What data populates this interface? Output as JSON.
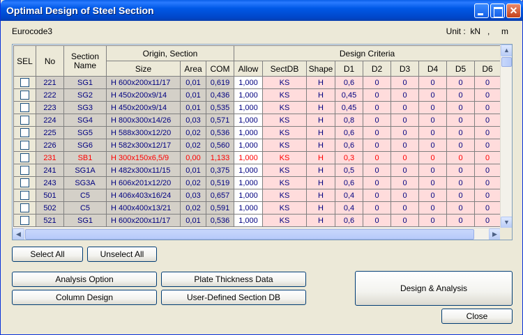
{
  "window": {
    "title": "Optimal Design of Steel Section",
    "code": "Eurocode3",
    "unit_text": "Unit :  kN   ,     m"
  },
  "table": {
    "group_headers": {
      "origin": "Origin, Section",
      "criteria": "Design Criteria"
    },
    "columns": {
      "sel": "SEL",
      "no": "No",
      "section_name": "Section Name",
      "size": "Size",
      "area": "Area",
      "com": "COM",
      "allow": "Allow",
      "sectdb": "SectDB",
      "shape": "Shape",
      "d1": "D1",
      "d2": "D2",
      "d3": "D3",
      "d4": "D4",
      "d5": "D5",
      "d6": "D6"
    },
    "rows": [
      {
        "no": "221",
        "name": "SG1",
        "size": "H 600x200x11/17",
        "area": "0,01",
        "com": "0,619",
        "allow": "1,000",
        "sectdb": "KS",
        "shape": "H",
        "d1": "0,6",
        "d2": "0",
        "d3": "0",
        "d4": "0",
        "d5": "0",
        "d6": "0"
      },
      {
        "no": "222",
        "name": "SG2",
        "size": "H 450x200x9/14",
        "area": "0,01",
        "com": "0,436",
        "allow": "1,000",
        "sectdb": "KS",
        "shape": "H",
        "d1": "0,45",
        "d2": "0",
        "d3": "0",
        "d4": "0",
        "d5": "0",
        "d6": "0"
      },
      {
        "no": "223",
        "name": "SG3",
        "size": "H 450x200x9/14",
        "area": "0,01",
        "com": "0,535",
        "allow": "1,000",
        "sectdb": "KS",
        "shape": "H",
        "d1": "0,45",
        "d2": "0",
        "d3": "0",
        "d4": "0",
        "d5": "0",
        "d6": "0"
      },
      {
        "no": "224",
        "name": "SG4",
        "size": "H 800x300x14/26",
        "area": "0,03",
        "com": "0,571",
        "allow": "1,000",
        "sectdb": "KS",
        "shape": "H",
        "d1": "0,8",
        "d2": "0",
        "d3": "0",
        "d4": "0",
        "d5": "0",
        "d6": "0"
      },
      {
        "no": "225",
        "name": "SG5",
        "size": "H 588x300x12/20",
        "area": "0,02",
        "com": "0,536",
        "allow": "1,000",
        "sectdb": "KS",
        "shape": "H",
        "d1": "0,6",
        "d2": "0",
        "d3": "0",
        "d4": "0",
        "d5": "0",
        "d6": "0"
      },
      {
        "no": "226",
        "name": "SG6",
        "size": "H 582x300x12/17",
        "area": "0,02",
        "com": "0,560",
        "allow": "1,000",
        "sectdb": "KS",
        "shape": "H",
        "d1": "0,6",
        "d2": "0",
        "d3": "0",
        "d4": "0",
        "d5": "0",
        "d6": "0"
      },
      {
        "no": "231",
        "name": "SB1",
        "size": "H 300x150x6,5/9",
        "area": "0,00",
        "com": "1,133",
        "allow": "1,000",
        "sectdb": "KS",
        "shape": "H",
        "d1": "0,3",
        "d2": "0",
        "d3": "0",
        "d4": "0",
        "d5": "0",
        "d6": "0",
        "warn": true
      },
      {
        "no": "241",
        "name": "SG1A",
        "size": "H 482x300x11/15",
        "area": "0,01",
        "com": "0,375",
        "allow": "1,000",
        "sectdb": "KS",
        "shape": "H",
        "d1": "0,5",
        "d2": "0",
        "d3": "0",
        "d4": "0",
        "d5": "0",
        "d6": "0"
      },
      {
        "no": "243",
        "name": "SG3A",
        "size": "H 606x201x12/20",
        "area": "0,02",
        "com": "0,519",
        "allow": "1,000",
        "sectdb": "KS",
        "shape": "H",
        "d1": "0,6",
        "d2": "0",
        "d3": "0",
        "d4": "0",
        "d5": "0",
        "d6": "0"
      },
      {
        "no": "501",
        "name": "C5",
        "size": "H 406x403x16/24",
        "area": "0,03",
        "com": "0,657",
        "allow": "1,000",
        "sectdb": "KS",
        "shape": "H",
        "d1": "0,4",
        "d2": "0",
        "d3": "0",
        "d4": "0",
        "d5": "0",
        "d6": "0"
      },
      {
        "no": "502",
        "name": "C5",
        "size": "H 400x400x13/21",
        "area": "0,02",
        "com": "0,591",
        "allow": "1,000",
        "sectdb": "KS",
        "shape": "H",
        "d1": "0,4",
        "d2": "0",
        "d3": "0",
        "d4": "0",
        "d5": "0",
        "d6": "0"
      },
      {
        "no": "521",
        "name": "SG1",
        "size": "H 600x200x11/17",
        "area": "0,01",
        "com": "0,536",
        "allow": "1,000",
        "sectdb": "KS",
        "shape": "H",
        "d1": "0,6",
        "d2": "0",
        "d3": "0",
        "d4": "0",
        "d5": "0",
        "d6": "0"
      }
    ]
  },
  "buttons": {
    "select_all": "Select All",
    "unselect_all": "Unselect All",
    "analysis_option": "Analysis Option",
    "plate_thickness": "Plate Thickness Data",
    "column_design": "Column Design",
    "user_defined_db": "User-Defined Section DB",
    "design_analysis": "Design & Analysis",
    "close": "Close"
  },
  "colors": {
    "warning_text": "#ff0000",
    "value_text": "#000080",
    "criteria_bg": "#ffdcdc"
  }
}
